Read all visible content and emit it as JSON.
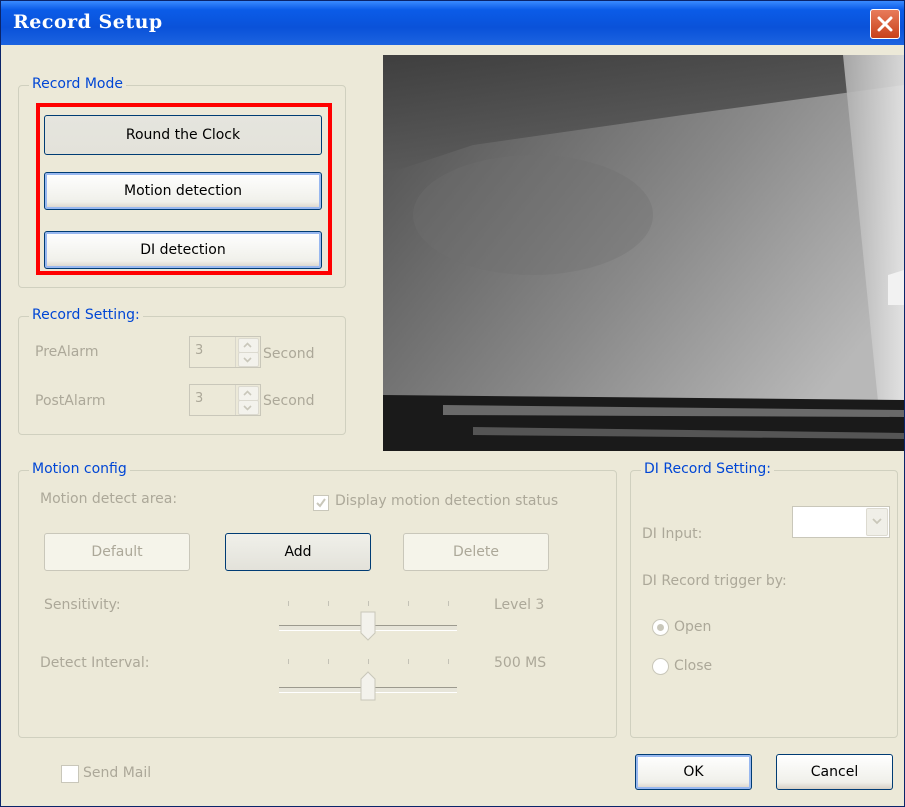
{
  "window": {
    "title": "Record Setup"
  },
  "record_mode": {
    "legend": "Record Mode",
    "buttons": [
      "Round the Clock",
      "Motion detection",
      "DI detection"
    ]
  },
  "record_setting": {
    "legend": "Record Setting:",
    "pre_alarm": {
      "label": "PreAlarm",
      "value": "3",
      "unit": "Second"
    },
    "post_alarm": {
      "label": "PostAlarm",
      "value": "3",
      "unit": "Second"
    }
  },
  "motion_config": {
    "legend": "Motion config",
    "area_label": "Motion detect area:",
    "display_status_label": "Display motion detection status",
    "display_status_checked": true,
    "buttons": {
      "default": "Default",
      "add": "Add",
      "delete": "Delete"
    },
    "sensitivity": {
      "label": "Sensitivity:",
      "value_text": "Level 3",
      "level": 3,
      "max": 5
    },
    "detect_interval": {
      "label": "Detect Interval:",
      "value_text": "500 MS",
      "position": 3,
      "max": 5
    }
  },
  "di_record_setting": {
    "legend": "DI Record Setting:",
    "input_label": "DI Input:",
    "trigger_label": "DI Record trigger by:",
    "options": [
      "Open",
      "Close"
    ],
    "selected": "Open"
  },
  "footer": {
    "send_mail_label": "Send Mail",
    "ok_label": "OK",
    "cancel_label": "Cancel"
  },
  "colors": {
    "title_bar": "#0a52d9",
    "highlight_border": "#ff0000",
    "group_legend": "#0046d5",
    "disabled_text": "#aca899",
    "dialog_bg": "#ece9d8"
  }
}
